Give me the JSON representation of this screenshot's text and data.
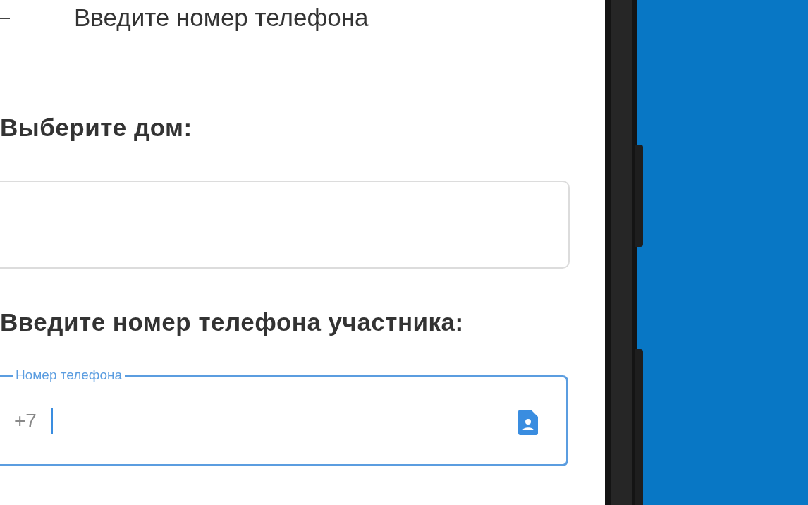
{
  "header": {
    "title": "Введите номер телефона"
  },
  "house": {
    "label": "Выберите дом:"
  },
  "phone": {
    "label": "Введите номер телефона участника:",
    "field_label": "Номер телефона",
    "prefix": "+7",
    "focused": true
  }
}
